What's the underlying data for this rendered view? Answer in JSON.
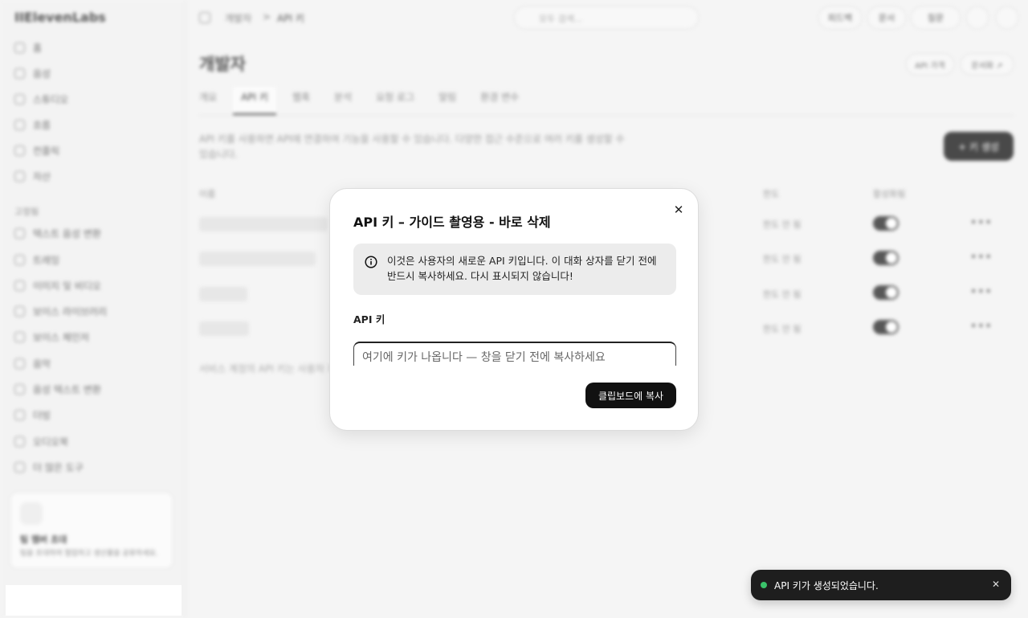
{
  "sidebar": {
    "logo": "IIElevenLabs",
    "items": [
      "홈",
      "음성",
      "스튜디오",
      "흐름",
      "컨플릭",
      "자산"
    ],
    "section_label": "고정됨",
    "tools": [
      "텍스트 음성 변환",
      "트레잉",
      "이미지 및 비디오",
      "보이스 라이브러리",
      "보이스 체인저",
      "음악",
      "음성 텍스트 변환",
      "더빙",
      "오디오북",
      "더 많은 도구"
    ],
    "invite": {
      "title": "팀 멤버 초대",
      "desc": "팀을 초대하여 협업하고 생산물을 공유하세요."
    }
  },
  "topbar": {
    "crumb_root": "개발자",
    "crumb_sep": ">",
    "crumb_current": "API 키",
    "search_placeholder": "모두 검색...",
    "buttons": [
      "피드백",
      "문서",
      "질문"
    ]
  },
  "page": {
    "title": "개발자",
    "header_buttons": [
      "API 가격",
      "문서화 ↗"
    ],
    "tabs": [
      "개요",
      "API 키",
      "웹훅",
      "분석",
      "요청 로그",
      "알림",
      "환경 변수"
    ],
    "description": "API 키를 사용하면 API에 연결하여 기능을 사용할 수 있습니다. 다양한 접근 수준으로 여러 키를 생성할 수 있습니다.",
    "create_button": "+ 키 생성",
    "columns": [
      "이름",
      "한도",
      "활성화됨"
    ],
    "rows_limit": [
      "한도 안 됨",
      "한도 안 됨",
      "한도 안 됨",
      "한도 안 됨"
    ],
    "more": "•••",
    "footnote": "서비스 계정의 API 키는 사용자 계정에 있습니다. 서비스 계정 설정에서 키를 관리하세요."
  },
  "modal": {
    "title": "API 키 – 가이드 촬영용 - 바로 삭제",
    "close": "✕",
    "notice": "이것은 사용자의 새로운 API 키입니다. 이 대화 상자를 닫기 전에 반드시 복사하세요. 다시 표시되지 않습니다!",
    "field_label": "API 키",
    "input_placeholder": "여기에 키가 나옵니다 — 창을 닫기 전에 복사하세요",
    "copy_button": "클립보드에 복사"
  },
  "toast": {
    "text": "API 키가 생성되었습니다.",
    "close": "✕",
    "dot_color": "#3ac26a"
  }
}
